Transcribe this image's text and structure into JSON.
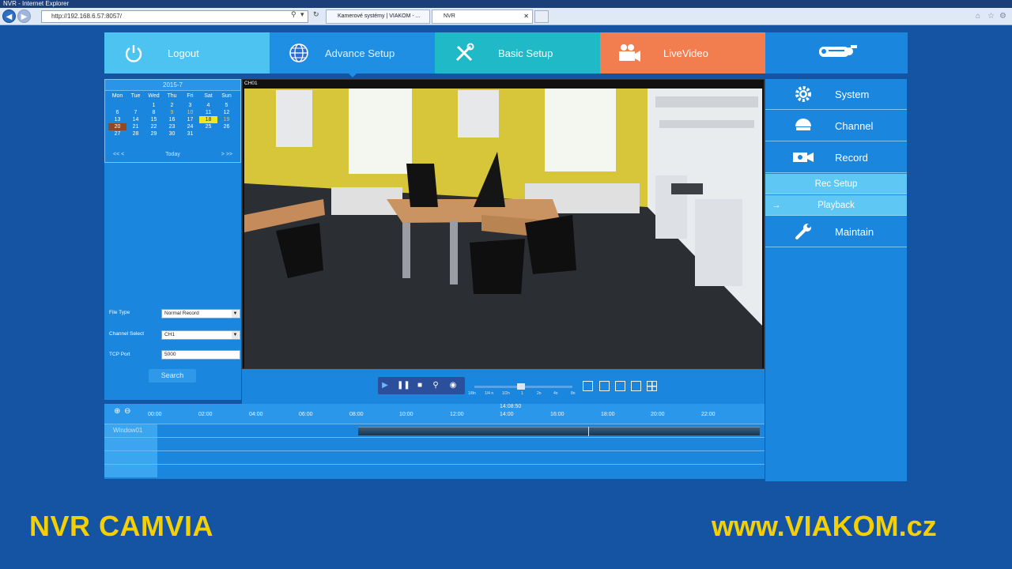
{
  "browser": {
    "title": "NVR - Internet Explorer",
    "address": "http://192.168.6.57:8057/",
    "tabs": [
      {
        "label": "Kamerové systémy | VIAKOM - ..."
      },
      {
        "label": "NVR"
      }
    ]
  },
  "topnav": {
    "logout": "Logout",
    "advance_setup": "Advance Setup",
    "basic_setup": "Basic Setup",
    "live_video": "LiveVideo"
  },
  "calendar": {
    "month": "2015-7",
    "weekdays": [
      "Mon",
      "Tue",
      "Wed",
      "Thu",
      "Fri",
      "Sat",
      "Sun"
    ],
    "weeks": [
      [
        "",
        "",
        "1",
        "2",
        "3",
        "4",
        "5"
      ],
      [
        "6",
        "7",
        "8",
        "9",
        "10",
        "11",
        "12"
      ],
      [
        "13",
        "14",
        "15",
        "16",
        "17",
        "18",
        "19"
      ],
      [
        "20",
        "21",
        "22",
        "23",
        "24",
        "25",
        "26"
      ],
      [
        "27",
        "28",
        "29",
        "30",
        "31",
        "",
        ""
      ]
    ],
    "today_label": "Today",
    "prev": "<< <",
    "next": "> >>"
  },
  "search": {
    "file_type_label": "File Type",
    "file_type_value": "Normal Record",
    "channel_label": "Channel Select",
    "channel_value": "CH1",
    "tcp_label": "TCP Port",
    "tcp_value": "5000",
    "button": "Search"
  },
  "video": {
    "channel": "CH01"
  },
  "playback": {
    "speeds": [
      "1/8n",
      "1/4 n",
      "1/2n",
      "1",
      "2n",
      "4n",
      "8n"
    ],
    "speed_value": "1"
  },
  "timeline": {
    "hours": [
      "00:00",
      "02:00",
      "04:00",
      "06:00",
      "08:00",
      "10:00",
      "12:00",
      "14:00",
      "16:00",
      "18:00",
      "20:00",
      "22:00"
    ],
    "cursor_time": "14:08:50",
    "window_label": "Window01"
  },
  "right_menu": {
    "system": "System",
    "channel": "Channel",
    "record": "Record",
    "rec_setup": "Rec Setup",
    "playback": "Playback",
    "maintain": "Maintain"
  },
  "footer": {
    "left": "NVR CAMVIA",
    "right": "www.VIAKOM.cz"
  },
  "colors": {
    "background": "#1553a3",
    "panel": "#1b86dd",
    "logout": "#4cc3f1",
    "advance": "#1e8fe2",
    "basic": "#1fb9c7",
    "live": "#f27d4f",
    "brand_yellow": "#f5d000"
  }
}
